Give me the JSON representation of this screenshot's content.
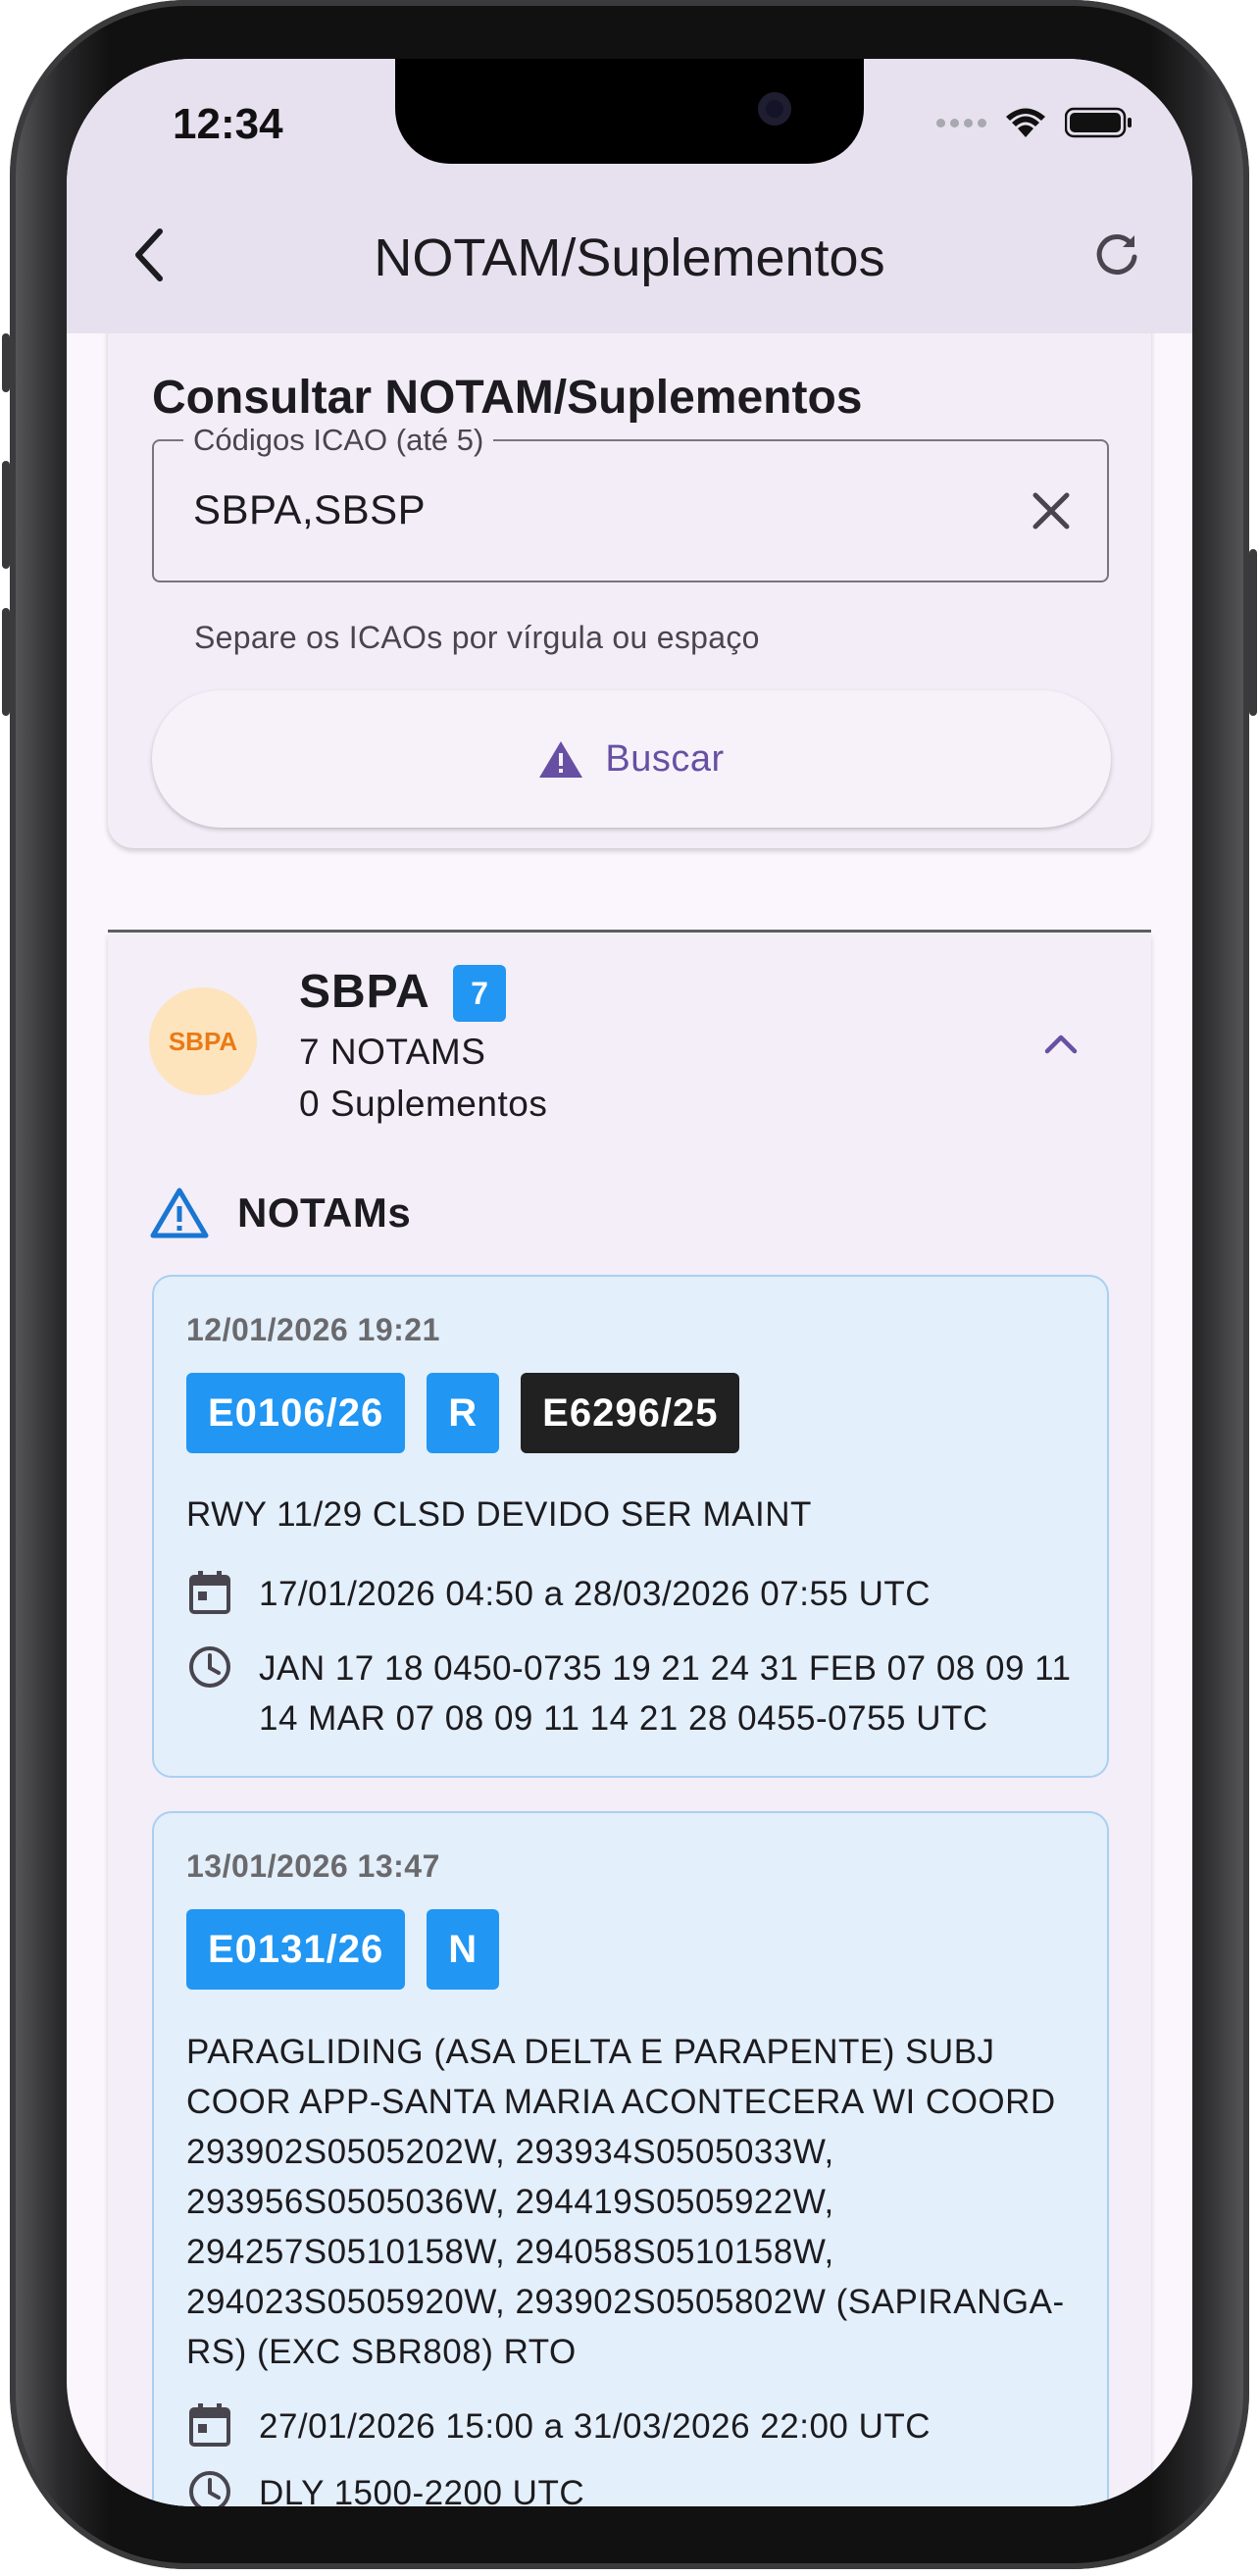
{
  "status_bar": {
    "time": "12:34"
  },
  "app_bar": {
    "title": "NOTAM/Suplementos"
  },
  "search": {
    "title": "Consultar NOTAM/Suplementos",
    "field_label": "Códigos ICAO (até 5)",
    "field_value": "SBPA,SBSP",
    "helper": "Separe os ICAOs por vírgula ou espaço",
    "button_label": "Buscar"
  },
  "airport": {
    "avatar_text": "SBPA",
    "code": "SBPA",
    "badge_count": "7",
    "notams_line": "7 NOTAMS",
    "suplementos_line": "0 Suplementos",
    "section_title": "NOTAMs"
  },
  "notams": [
    {
      "date": "12/01/2026 19:21",
      "chips": [
        {
          "label": "E0106/26",
          "style": "blue"
        },
        {
          "label": "R",
          "style": "blue"
        },
        {
          "label": "E6296/25",
          "style": "dark"
        }
      ],
      "text": "RWY 11/29 CLSD DEVIDO SER MAINT",
      "period": "17/01/2026 04:50 a 28/03/2026 07:55 UTC",
      "schedule": "JAN 17 18 0450-0735 19 21 24 31 FEB 07 08 09 11 14 MAR 07 08 09 11 14 21 28 0455-0755 UTC"
    },
    {
      "date": "13/01/2026 13:47",
      "chips": [
        {
          "label": "E0131/26",
          "style": "blue"
        },
        {
          "label": "N",
          "style": "blue"
        }
      ],
      "text": "PARAGLIDING (ASA DELTA E PARAPENTE) SUBJ COOR APP-SANTA MARIA ACONTECERA WI COORD 293902S0505202W, 293934S0505033W, 293956S0505036W, 294419S0505922W, 294257S0510158W, 294058S0510158W, 294023S0505920W, 293902S0505802W (SAPIRANGA-RS) (EXC SBR808) RTO",
      "period": "27/01/2026 15:00 a 31/03/2026 22:00 UTC",
      "schedule": "DLY 1500-2200 UTC"
    }
  ],
  "colors": {
    "primary": "#6750a4",
    "chip_blue": "#2196f3",
    "chip_dark": "#212121",
    "notam_bg": "#e3effa",
    "app_bar": "#e7e1ef"
  }
}
